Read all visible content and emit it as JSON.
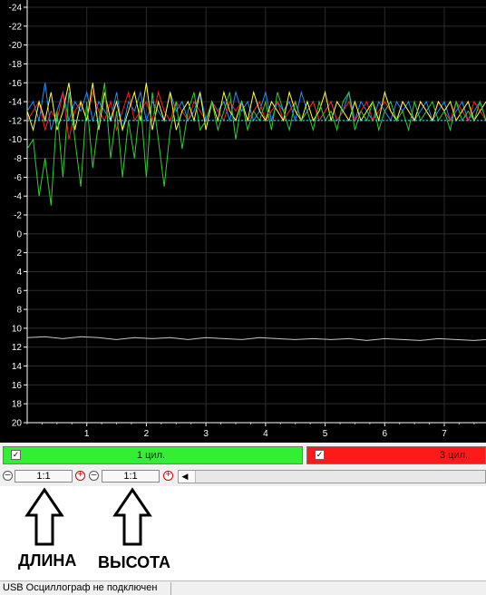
{
  "chart_data": {
    "type": "line",
    "y_ticks": [
      "-24",
      "-22",
      "-20",
      "-18",
      "-16",
      "-14",
      "-12",
      "-10",
      "-8",
      "-6",
      "-4",
      "-2",
      "0",
      "2",
      "4",
      "6",
      "8",
      "10",
      "12",
      "14",
      "16",
      "18",
      "20"
    ],
    "y_range": [
      -24,
      20
    ],
    "x_ticks": [
      "1",
      "2",
      "3",
      "4",
      "5",
      "6",
      "7"
    ],
    "x_range": [
      0,
      7.7
    ],
    "grid": true,
    "series": [
      {
        "color": "#1e90ff",
        "x": [
          0,
          0.1,
          0.2,
          0.3,
          0.4,
          0.5,
          0.6,
          0.7,
          0.8,
          0.9,
          1.0,
          1.1,
          1.2,
          1.3,
          1.4,
          1.5,
          1.6,
          1.7,
          1.8,
          1.9,
          2.0,
          2.1,
          2.2,
          2.3,
          2.4,
          2.5,
          2.6,
          2.7,
          2.8,
          2.9,
          3.0,
          3.1,
          3.2,
          3.3,
          3.4,
          3.5,
          3.6,
          3.7,
          3.8,
          3.9,
          4.0,
          4.1,
          4.2,
          4.3,
          4.4,
          4.5,
          4.6,
          4.7,
          4.8,
          4.9,
          5.0,
          5.1,
          5.2,
          5.3,
          5.4,
          5.5,
          5.6,
          5.7,
          5.8,
          5.9,
          6.0,
          6.1,
          6.2,
          6.3,
          6.4,
          6.5,
          6.6,
          6.7,
          6.8,
          6.9,
          7.0,
          7.1,
          7.2,
          7.3,
          7.4,
          7.5,
          7.6,
          7.7
        ],
        "y": [
          -13,
          -14,
          -12,
          -16,
          -11,
          -13,
          -15,
          -12,
          -14,
          -13,
          -15,
          -12,
          -14,
          -13,
          -12,
          -15,
          -11,
          -14,
          -13,
          -15,
          -12,
          -14,
          -13,
          -12,
          -15,
          -13,
          -14,
          -12,
          -13,
          -15,
          -12,
          -14,
          -13,
          -14,
          -12,
          -15,
          -13,
          -14,
          -12,
          -13,
          -15,
          -12,
          -14,
          -13,
          -14,
          -12,
          -15,
          -13,
          -14,
          -12,
          -13,
          -14,
          -12,
          -13,
          -15,
          -12,
          -14,
          -13,
          -12,
          -14,
          -13,
          -12,
          -14,
          -13,
          -14,
          -12,
          -13,
          -14,
          -12,
          -13,
          -14,
          -12,
          -13,
          -14,
          -12,
          -13,
          -14,
          -12
        ]
      },
      {
        "color": "#ff2020",
        "x": [
          0,
          0.1,
          0.2,
          0.3,
          0.4,
          0.5,
          0.6,
          0.7,
          0.8,
          0.9,
          1.0,
          1.1,
          1.2,
          1.3,
          1.4,
          1.5,
          1.6,
          1.7,
          1.8,
          1.9,
          2.0,
          2.1,
          2.2,
          2.3,
          2.4,
          2.5,
          2.6,
          2.7,
          2.8,
          2.9,
          3.0,
          3.1,
          3.2,
          3.3,
          3.4,
          3.5,
          3.6,
          3.7,
          3.8,
          3.9,
          4.0,
          4.1,
          4.2,
          4.3,
          4.4,
          4.5,
          4.6,
          4.7,
          4.8,
          4.9,
          5.0,
          5.1,
          5.2,
          5.3,
          5.4,
          5.5,
          5.6,
          5.7,
          5.8,
          5.9,
          6.0,
          6.1,
          6.2,
          6.3,
          6.4,
          6.5,
          6.6,
          6.7,
          6.8,
          6.9,
          7.0,
          7.1,
          7.2,
          7.3,
          7.4,
          7.5,
          7.6,
          7.7
        ],
        "y": [
          -12,
          -13,
          -14,
          -11,
          -13,
          -12,
          -15,
          -10,
          -13,
          -14,
          -12,
          -15,
          -13,
          -12,
          -14,
          -11,
          -13,
          -15,
          -12,
          -13,
          -14,
          -12,
          -15,
          -13,
          -12,
          -14,
          -13,
          -12,
          -14,
          -13,
          -12,
          -14,
          -13,
          -12,
          -14,
          -13,
          -14,
          -12,
          -13,
          -14,
          -12,
          -13,
          -14,
          -12,
          -13,
          -14,
          -12,
          -13,
          -14,
          -12,
          -13,
          -14,
          -12,
          -13,
          -14,
          -12,
          -13,
          -14,
          -12,
          -13,
          -14,
          -13,
          -12,
          -14,
          -13,
          -12,
          -14,
          -13,
          -12,
          -14,
          -13,
          -12,
          -14,
          -13,
          -12,
          -14,
          -13,
          -12
        ]
      },
      {
        "color": "#ffff40",
        "x": [
          0,
          0.1,
          0.2,
          0.3,
          0.4,
          0.5,
          0.6,
          0.7,
          0.8,
          0.9,
          1.0,
          1.1,
          1.2,
          1.3,
          1.4,
          1.5,
          1.6,
          1.7,
          1.8,
          1.9,
          2.0,
          2.1,
          2.2,
          2.3,
          2.4,
          2.5,
          2.6,
          2.7,
          2.8,
          2.9,
          3.0,
          3.1,
          3.2,
          3.3,
          3.4,
          3.5,
          3.6,
          3.7,
          3.8,
          3.9,
          4.0,
          4.1,
          4.2,
          4.3,
          4.4,
          4.5,
          4.6,
          4.7,
          4.8,
          4.9,
          5.0,
          5.1,
          5.2,
          5.3,
          5.4,
          5.5,
          5.6,
          5.7,
          5.8,
          5.9,
          6.0,
          6.1,
          6.2,
          6.3,
          6.4,
          6.5,
          6.6,
          6.7,
          6.8,
          6.9,
          7.0,
          7.1,
          7.2,
          7.3,
          7.4,
          7.5,
          7.6,
          7.7
        ],
        "y": [
          -13,
          -11,
          -14,
          -12,
          -15,
          -11,
          -13,
          -16,
          -11,
          -14,
          -12,
          -16,
          -11,
          -15,
          -12,
          -14,
          -11,
          -13,
          -15,
          -12,
          -16,
          -11,
          -14,
          -12,
          -15,
          -11,
          -13,
          -14,
          -12,
          -15,
          -11,
          -14,
          -12,
          -15,
          -13,
          -12,
          -14,
          -12,
          -15,
          -13,
          -12,
          -14,
          -13,
          -12,
          -15,
          -13,
          -12,
          -14,
          -12,
          -13,
          -15,
          -12,
          -14,
          -13,
          -12,
          -14,
          -12,
          -13,
          -14,
          -12,
          -15,
          -13,
          -12,
          -14,
          -13,
          -12,
          -14,
          -13,
          -12,
          -14,
          -13,
          -14,
          -12,
          -13,
          -14,
          -12,
          -13,
          -14
        ]
      },
      {
        "color": "#33cc33",
        "x": [
          0,
          0.1,
          0.2,
          0.3,
          0.4,
          0.5,
          0.6,
          0.7,
          0.8,
          0.9,
          1.0,
          1.1,
          1.2,
          1.3,
          1.4,
          1.5,
          1.6,
          1.7,
          1.8,
          1.9,
          2.0,
          2.1,
          2.2,
          2.3,
          2.4,
          2.5,
          2.6,
          2.7,
          2.8,
          2.9,
          3.0,
          3.1,
          3.2,
          3.3,
          3.4,
          3.5,
          3.6,
          3.7,
          3.8,
          3.9,
          4.0,
          4.1,
          4.2,
          4.3,
          4.4,
          4.5,
          4.6,
          4.7,
          4.8,
          4.9,
          5.0,
          5.1,
          5.2,
          5.3,
          5.4,
          5.5,
          5.6,
          5.7,
          5.8,
          5.9,
          6.0,
          6.1,
          6.2,
          6.3,
          6.4,
          6.5,
          6.6,
          6.7,
          6.8,
          6.9,
          7.0,
          7.1,
          7.2,
          7.3,
          7.4,
          7.5,
          7.6,
          7.7
        ],
        "y": [
          -9,
          -10,
          -4,
          -8,
          -3,
          -13,
          -6,
          -15,
          -10,
          -5,
          -14,
          -7,
          -12,
          -16,
          -8,
          -13,
          -6,
          -12,
          -8,
          -14,
          -6,
          -15,
          -10,
          -5,
          -11,
          -14,
          -9,
          -13,
          -15,
          -11,
          -12,
          -14,
          -11,
          -13,
          -15,
          -10,
          -14,
          -11,
          -13,
          -12,
          -14,
          -11,
          -15,
          -13,
          -11,
          -14,
          -12,
          -13,
          -11,
          -14,
          -12,
          -13,
          -11,
          -14,
          -15,
          -11,
          -13,
          -12,
          -14,
          -11,
          -13,
          -14,
          -12,
          -13,
          -11,
          -14,
          -12,
          -13,
          -14,
          -12,
          -13,
          -11,
          -14,
          -12,
          -13,
          -12,
          -14,
          -12
        ]
      },
      {
        "color": "#40e0ff",
        "x": [
          0,
          7.7
        ],
        "y": [
          -12,
          -12
        ]
      },
      {
        "color": "#c8c8c8",
        "x": [
          0,
          0.3,
          0.6,
          0.9,
          1.2,
          1.5,
          1.8,
          2.1,
          2.4,
          2.7,
          3.0,
          3.3,
          3.6,
          3.9,
          4.2,
          4.5,
          4.8,
          5.1,
          5.4,
          5.7,
          6.0,
          6.3,
          6.6,
          6.9,
          7.2,
          7.5,
          7.7
        ],
        "y": [
          11,
          10.9,
          11.1,
          10.9,
          11.0,
          11.2,
          11.0,
          11.1,
          11.0,
          11.2,
          11.0,
          11.1,
          11.2,
          11.0,
          11.1,
          11.2,
          11.1,
          11.2,
          11.1,
          11.3,
          11.1,
          11.2,
          11.3,
          11.1,
          11.2,
          11.3,
          11.2
        ]
      }
    ]
  },
  "channels": [
    {
      "label": "1 цил.",
      "color": "#33ee33",
      "checked": "✓"
    },
    {
      "label": "3 цил.",
      "color": "#ff1a1a",
      "checked": "✓"
    }
  ],
  "zoom": {
    "length_value": "1:1",
    "height_value": "1:1"
  },
  "annotation": {
    "length_label": "ДЛИНА",
    "height_label": "ВЫСОТА"
  },
  "status": {
    "text": "USB Осциллограф не подключен"
  }
}
